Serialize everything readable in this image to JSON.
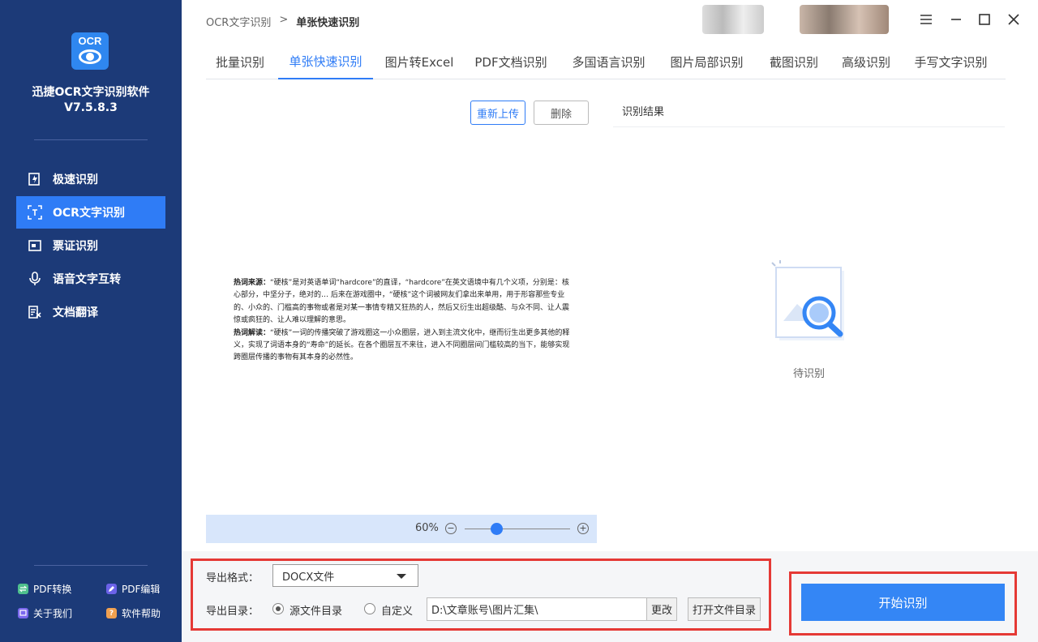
{
  "app": {
    "name": "迅捷OCR文字识别软件",
    "version": "V7.5.8.3",
    "logo_text": "OCR",
    "accent": "#2f7cf6"
  },
  "sidebar": {
    "items": [
      {
        "label": "极速识别",
        "icon": "fast-scan-icon"
      },
      {
        "label": "OCR文字识别",
        "icon": "ocr-scan-icon",
        "active": true
      },
      {
        "label": "票证识别",
        "icon": "ticket-icon"
      },
      {
        "label": "语音文字互转",
        "icon": "microphone-icon"
      },
      {
        "label": "文档翻译",
        "icon": "translate-icon"
      }
    ],
    "footer": [
      {
        "label": "PDF转换",
        "icon": "pdf-convert-icon"
      },
      {
        "label": "PDF编辑",
        "icon": "pdf-edit-icon"
      },
      {
        "label": "关于我们",
        "icon": "about-icon"
      },
      {
        "label": "软件帮助",
        "icon": "help-icon"
      }
    ]
  },
  "breadcrumb": {
    "root": "OCR文字识别",
    "sep": ">",
    "current": "单张快速识别"
  },
  "tabs": [
    "批量识别",
    "单张快速识别",
    "图片转Excel",
    "PDF文档识别",
    "多国语言识别",
    "图片局部识别",
    "截图识别",
    "高级识别",
    "手写文字识别"
  ],
  "active_tab": 1,
  "preview": {
    "reupload": "重新上传",
    "delete": "删除",
    "doc": {
      "p1_label": "热词来源：",
      "p1_text": "“硬核”是对英语单词“hardcore”的直译，“hardcore”在英文语境中有几个义项，分别是：核心部分，中坚分子，绝对的… 后来在游戏圈中，“硬核”这个词被网友们拿出来单用，用于形容那些专业的、小众的、门槛高的事物或者是对某一事情专精又狂热的人，然后又衍生出超级酷、与众不同、让人震惊或疯狂的、让人难以理解的意思。",
      "p2_label": "热词解读：",
      "p2_text": "“硬核”一词的传播突破了游戏圈这一小众圈层，进入到主流文化中，继而衍生出更多其他的释义，实现了词语本身的“寿命”的延长。在各个圈层互不来往，进入不同圈层间门槛较高的当下，能够实现跨圈层传播的事物有其本身的必然性。"
    },
    "zoom": "60%",
    "zoom_level": 0.3
  },
  "result": {
    "title": "识别结果",
    "status": "待识别"
  },
  "export": {
    "format_label": "导出格式：",
    "format_value": "DOCX文件",
    "dir_label": "导出目录：",
    "opt_source": "源文件目录",
    "opt_custom": "自定义",
    "path": "D:\\文章账号\\图片汇集\\",
    "change": "更改",
    "open_dir": "打开文件目录"
  },
  "start_button": "开始识别"
}
